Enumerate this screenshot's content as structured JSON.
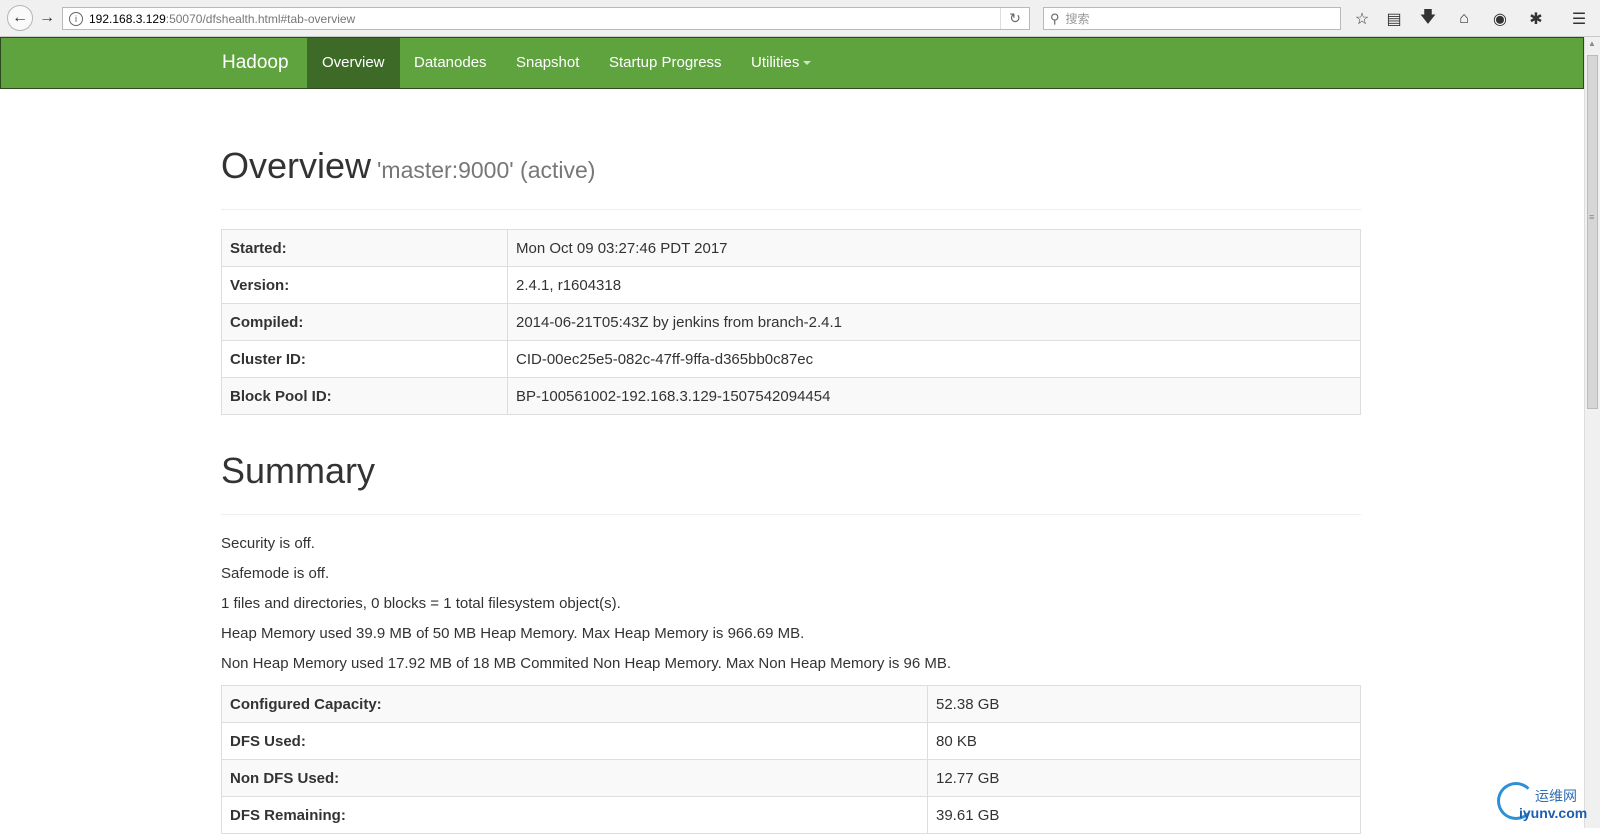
{
  "browser": {
    "url_host": "192.168.3.129",
    "url_path": ":50070/dfshealth.html#tab-overview",
    "search_placeholder": "搜索"
  },
  "navbar": {
    "brand": "Hadoop",
    "items": [
      {
        "label": "Overview",
        "active": true
      },
      {
        "label": "Datanodes"
      },
      {
        "label": "Snapshot"
      },
      {
        "label": "Startup Progress"
      },
      {
        "label": "Utilities"
      }
    ]
  },
  "overview": {
    "heading": "Overview",
    "subheading": "'master:9000' (active)",
    "rows": [
      {
        "key": "Started:",
        "value": "Mon Oct 09 03:27:46 PDT 2017"
      },
      {
        "key": "Version:",
        "value": "2.4.1, r1604318"
      },
      {
        "key": "Compiled:",
        "value": "2014-06-21T05:43Z by jenkins from branch-2.4.1"
      },
      {
        "key": "Cluster ID:",
        "value": "CID-00ec25e5-082c-47ff-9ffa-d365bb0c87ec"
      },
      {
        "key": "Block Pool ID:",
        "value": "BP-100561002-192.168.3.129-1507542094454"
      }
    ]
  },
  "summary": {
    "heading": "Summary",
    "lines": [
      "Security is off.",
      "Safemode is off.",
      "1 files and directories, 0 blocks = 1 total filesystem object(s).",
      "Heap Memory used 39.9 MB of 50 MB Heap Memory. Max Heap Memory is 966.69 MB.",
      "Non Heap Memory used 17.92 MB of 18 MB Commited Non Heap Memory. Max Non Heap Memory is 96 MB."
    ],
    "rows": [
      {
        "key": "Configured Capacity:",
        "value": "52.38 GB"
      },
      {
        "key": "DFS Used:",
        "value": "80 KB"
      },
      {
        "key": "Non DFS Used:",
        "value": "12.77 GB"
      },
      {
        "key": "DFS Remaining:",
        "value": "39.61 GB"
      }
    ]
  },
  "watermark": {
    "cn": "运维网",
    "en": "iyunv.com"
  }
}
